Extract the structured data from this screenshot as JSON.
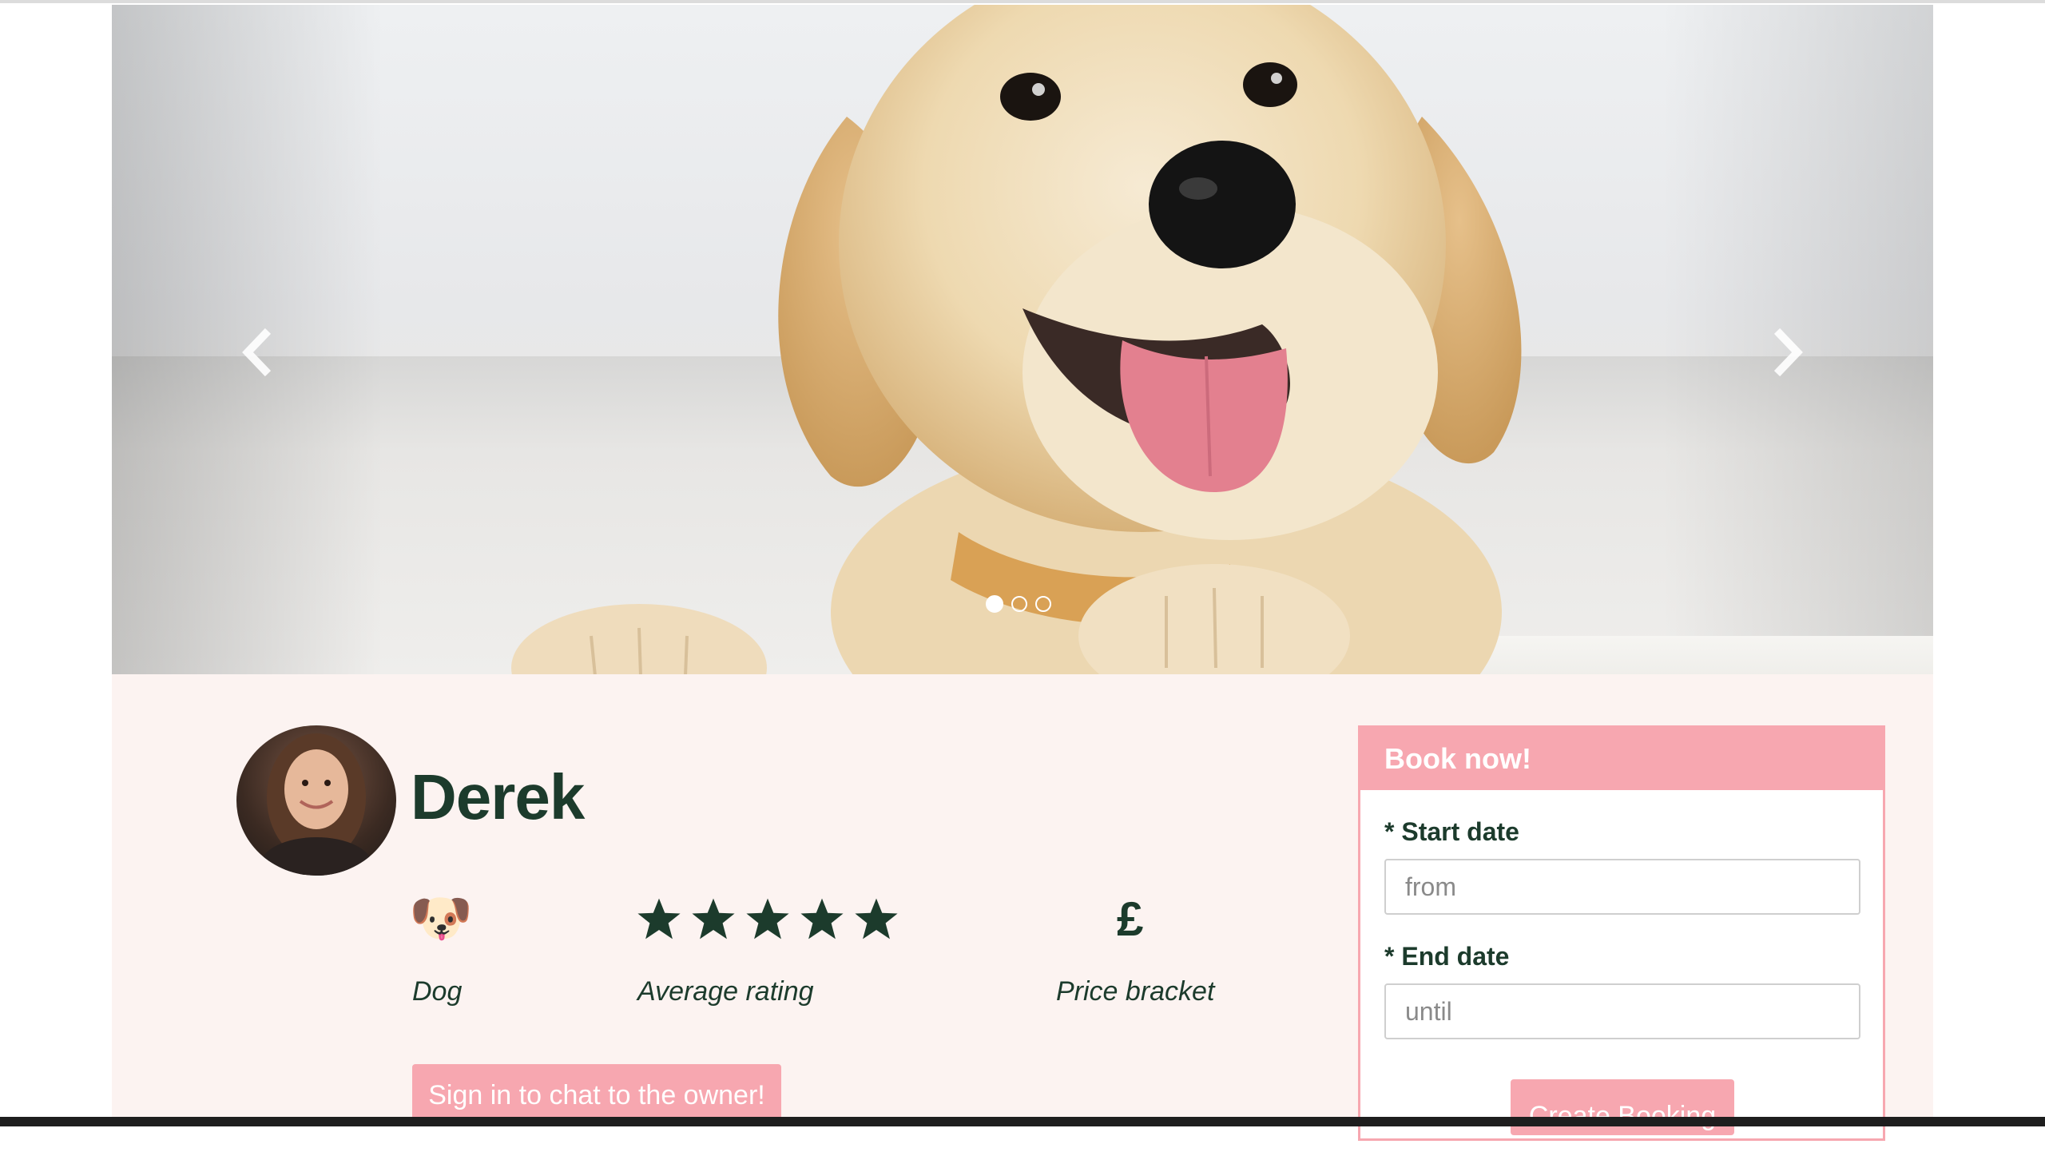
{
  "carousel": {
    "image_alt": "golden retriever puppy",
    "slide_count": 3,
    "active_slide": 0,
    "prev_icon": "chevron-left-icon",
    "next_icon": "chevron-right-icon"
  },
  "profile": {
    "owner_name": "Derek",
    "stats": [
      {
        "icon": "dog-face-icon",
        "glyph": "🐶",
        "label": "Dog"
      },
      {
        "icon": "star-icon",
        "stars": 5,
        "label": "Average rating"
      },
      {
        "icon": "pound-icon",
        "glyph": "£",
        "label": "Price bracket"
      }
    ],
    "chat_button": "Sign in to chat to the owner!"
  },
  "booking": {
    "title": "Book now!",
    "start_label": "* Start date",
    "start_placeholder": "from",
    "end_label": "* End date",
    "end_placeholder": "until",
    "submit": "Create Booking"
  },
  "colors": {
    "accent_pink": "#f7a7b0",
    "text_green": "#1c3b2c",
    "panel_bg": "#fcf3f1"
  }
}
